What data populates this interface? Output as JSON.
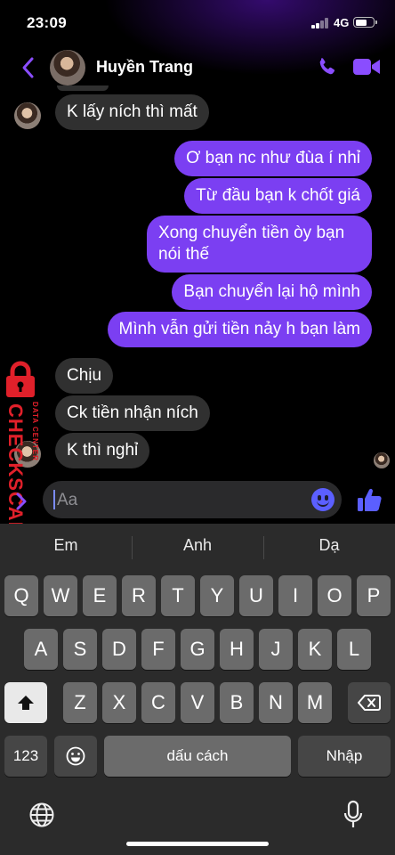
{
  "status_bar": {
    "time": "23:09",
    "network": "4G",
    "battery_level": 0.65
  },
  "header": {
    "contact_name": "Huyền Trang",
    "back_icon": "chevron-left-icon",
    "call_icon": "phone-icon",
    "video_icon": "video-camera-icon",
    "accent_color": "#8a4dff"
  },
  "messages": [
    {
      "sender": "contact",
      "text": "K lấy ních thì mất"
    },
    {
      "sender": "me",
      "text": "Ơ bạn nc như đùa í nhỉ"
    },
    {
      "sender": "me",
      "text": "Từ đầu bạn k chốt giá"
    },
    {
      "sender": "me",
      "text": "Xong chuyển tiền òy bạn nói thế"
    },
    {
      "sender": "me",
      "text": "Bạn chuyển lại hộ mình"
    },
    {
      "sender": "me",
      "text": "Mình vẫn gửi tiền nảy h bạn làm"
    },
    {
      "sender": "contact",
      "text": "Chịu"
    },
    {
      "sender": "contact",
      "text": "Ck tiền nhận ních"
    },
    {
      "sender": "contact",
      "text": "K thì nghỉ"
    }
  ],
  "bubble_colors": {
    "outgoing": "#7b3ff2",
    "incoming": "#303030"
  },
  "composer": {
    "placeholder": "Aa",
    "emoji_icon": "smiley-emoji-icon",
    "like_icon": "thumbs-up-icon",
    "expand_icon": "chevron-right-icon"
  },
  "watermark": {
    "brand": "CHECKSCAM.INFO",
    "subtitle": "DATA CENTER",
    "icon": "padlock-icon"
  },
  "keyboard": {
    "suggestions": [
      "Em",
      "Anh",
      "Dạ"
    ],
    "row1": [
      "Q",
      "W",
      "E",
      "R",
      "T",
      "Y",
      "U",
      "I",
      "O",
      "P"
    ],
    "row2": [
      "A",
      "S",
      "D",
      "F",
      "G",
      "H",
      "J",
      "K",
      "L"
    ],
    "row3": [
      "Z",
      "X",
      "C",
      "V",
      "B",
      "N",
      "M"
    ],
    "numbers_label": "123",
    "space_label": "dấu cách",
    "return_label": "Nhập",
    "shift_icon": "shift-arrow-icon",
    "delete_icon": "backspace-icon",
    "emoji_key_icon": "emoji-icon",
    "globe_icon": "globe-icon",
    "mic_icon": "microphone-icon"
  }
}
